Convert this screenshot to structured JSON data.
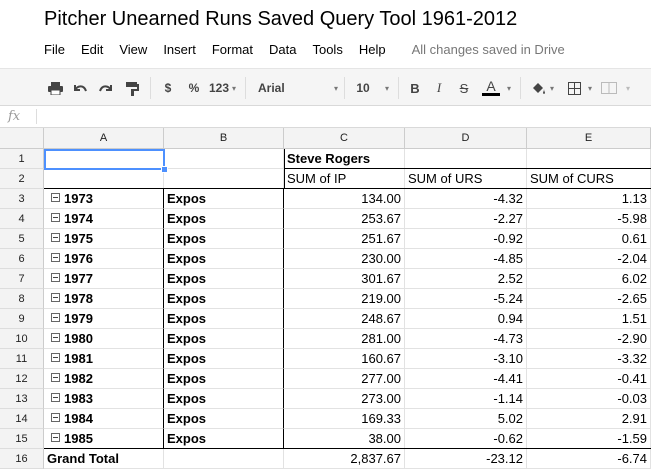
{
  "doc": {
    "title": "Pitcher Unearned Runs Saved Query Tool 1961-2012",
    "save_status": "All changes saved in Drive"
  },
  "menu": [
    "File",
    "Edit",
    "View",
    "Insert",
    "Format",
    "Data",
    "Tools",
    "Help"
  ],
  "toolbar": {
    "currency": "$",
    "percent": "%",
    "more_formats": "123",
    "font": "Arial",
    "font_size": "10",
    "bold": "B",
    "italic": "I",
    "strike": "S",
    "text_color": "A",
    "text_color_underline": "#000000"
  },
  "formula_bar": {
    "fx": "fx",
    "content": ""
  },
  "columns": [
    "A",
    "B",
    "C",
    "D",
    "E"
  ],
  "row_numbers": [
    "1",
    "2",
    "3",
    "4",
    "5",
    "6",
    "7",
    "8",
    "9",
    "10",
    "11",
    "12",
    "13",
    "14",
    "15",
    "16"
  ],
  "pivot": {
    "pitcher": "Steve Rogers",
    "headers": [
      "SUM of IP",
      "SUM of URS",
      "SUM of CURS"
    ],
    "rows": [
      {
        "year": "1973",
        "team": "Expos",
        "ip": "134.00",
        "urs": "-4.32",
        "curs": "1.13"
      },
      {
        "year": "1974",
        "team": "Expos",
        "ip": "253.67",
        "urs": "-2.27",
        "curs": "-5.98"
      },
      {
        "year": "1975",
        "team": "Expos",
        "ip": "251.67",
        "urs": "-0.92",
        "curs": "0.61"
      },
      {
        "year": "1976",
        "team": "Expos",
        "ip": "230.00",
        "urs": "-4.85",
        "curs": "-2.04"
      },
      {
        "year": "1977",
        "team": "Expos",
        "ip": "301.67",
        "urs": "2.52",
        "curs": "6.02"
      },
      {
        "year": "1978",
        "team": "Expos",
        "ip": "219.00",
        "urs": "-5.24",
        "curs": "-2.65"
      },
      {
        "year": "1979",
        "team": "Expos",
        "ip": "248.67",
        "urs": "0.94",
        "curs": "1.51"
      },
      {
        "year": "1980",
        "team": "Expos",
        "ip": "281.00",
        "urs": "-4.73",
        "curs": "-2.90"
      },
      {
        "year": "1981",
        "team": "Expos",
        "ip": "160.67",
        "urs": "-3.10",
        "curs": "-3.32"
      },
      {
        "year": "1982",
        "team": "Expos",
        "ip": "277.00",
        "urs": "-4.41",
        "curs": "-0.41"
      },
      {
        "year": "1983",
        "team": "Expos",
        "ip": "273.00",
        "urs": "-1.14",
        "curs": "-0.03"
      },
      {
        "year": "1984",
        "team": "Expos",
        "ip": "169.33",
        "urs": "5.02",
        "curs": "2.91"
      },
      {
        "year": "1985",
        "team": "Expos",
        "ip": "38.00",
        "urs": "-0.62",
        "curs": "-1.59"
      }
    ],
    "grand_total": {
      "label": "Grand Total",
      "ip": "2,837.67",
      "urs": "-23.12",
      "curs": "-6.74"
    }
  },
  "colors": {
    "selection": "#4d90fe",
    "header_bg": "#f3f3f3",
    "toolbar_bg": "#f5f5f5"
  }
}
